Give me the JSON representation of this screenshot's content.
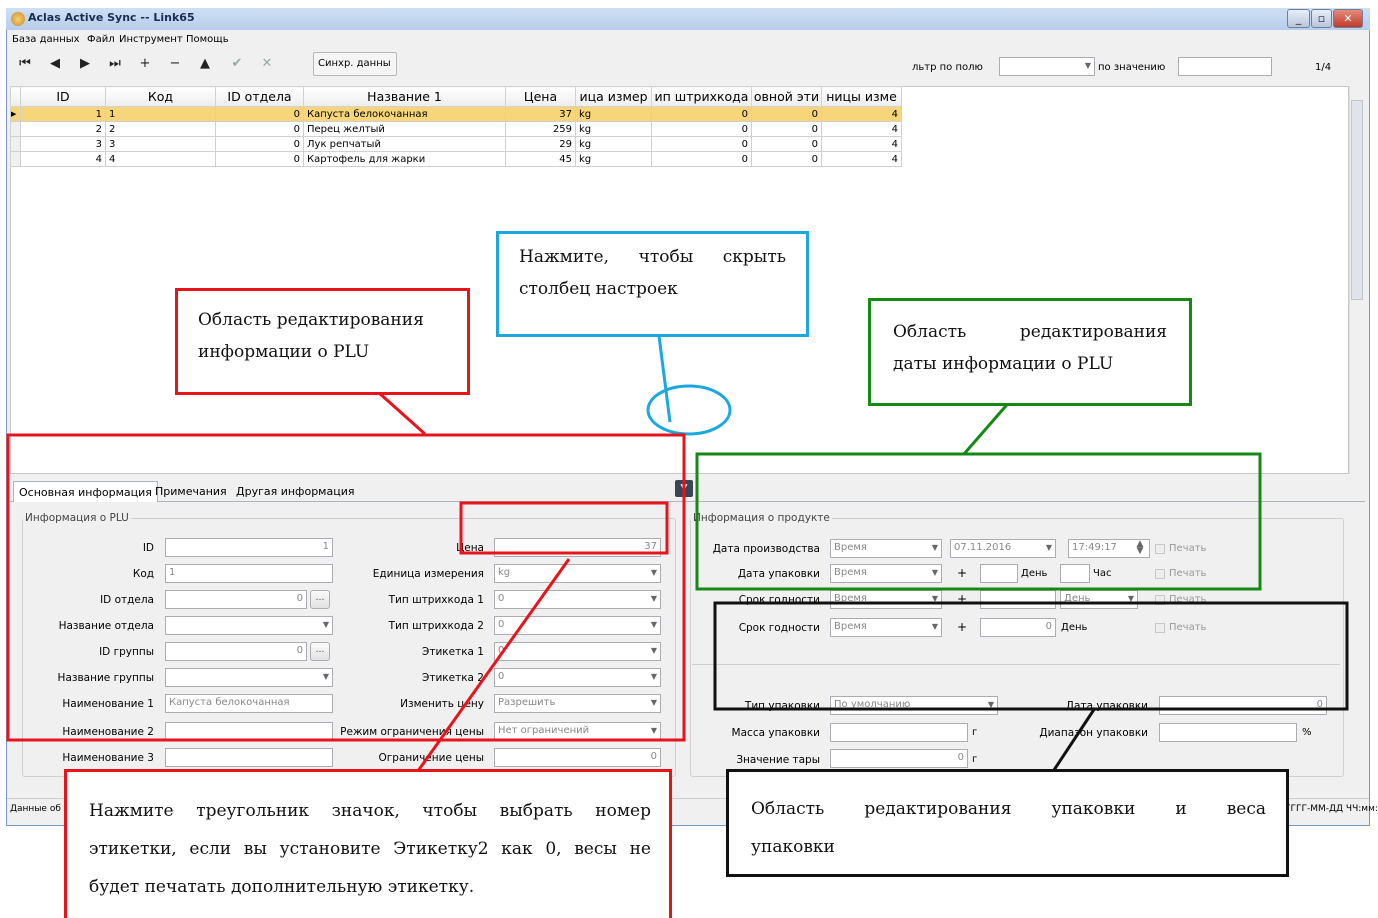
{
  "window": {
    "title": "Aclas Active Sync -- Link65",
    "buttons": [
      "_",
      "▫",
      "✕"
    ]
  },
  "menu": [
    "База данных",
    "Файл",
    "Инструмент",
    "Помощь"
  ],
  "toolbar": {
    "nav": [
      "⏮",
      "◀",
      "▶",
      "⏭",
      "+",
      "−",
      "▲",
      "✔",
      "✕"
    ],
    "sync_label": "Синхр. данны",
    "filter_field_label": "льтр по полю",
    "filter_value_label": "по значению",
    "filter_field_value": "",
    "filter_value": "",
    "page": "1/4"
  },
  "grid": {
    "columns": [
      "ID",
      "Код",
      "ID отдела",
      "Название 1",
      "Цена",
      "ица измер",
      "ип штрихкода",
      "овной эти",
      "ницы изме"
    ],
    "rows": [
      [
        "1",
        "1",
        "0",
        "Капуста белокочанная",
        "37",
        "kg",
        "0",
        "0",
        "4"
      ],
      [
        "2",
        "2",
        "0",
        "Перец желтый",
        "259",
        "kg",
        "0",
        "0",
        "4"
      ],
      [
        "3",
        "3",
        "0",
        "Лук репчатый",
        "29",
        "kg",
        "0",
        "0",
        "4"
      ],
      [
        "4",
        "4",
        "0",
        "Картофель для жарки",
        "45",
        "kg",
        "0",
        "0",
        "4"
      ]
    ]
  },
  "tabs": [
    "Основная информация",
    "Примечания",
    "Другая информация"
  ],
  "collapse_glyph": "▼",
  "plu": {
    "group": "Информация о PLU",
    "labels": {
      "id": "ID",
      "code": "Код",
      "dept_id": "ID отдела",
      "dept_name": "Название отдела",
      "group_id": "ID группы",
      "group_name": "Название группы",
      "name1": "Наименование 1",
      "name2": "Наименование 2",
      "name3": "Наименование 3"
    },
    "values": {
      "id": "1",
      "code": "1",
      "dept_id": "0",
      "dept_name": "",
      "group_id": "0",
      "group_name": "",
      "name1": "Капуста белокочанная",
      "name2": "",
      "name3": ""
    },
    "right_labels": {
      "price": "Цена",
      "unit": "Единица измерения",
      "bc1": "Тип штрихкода 1",
      "bc2": "Тип штрихкода 2",
      "label1": "Этикетка 1",
      "label2": "Этикетка 2",
      "change_price": "Изменить цену",
      "price_limit_mode": "Режим ограничения цены",
      "price_limit": "Ограничение цены"
    },
    "right_values": {
      "price": "37",
      "unit": "kg",
      "bc1": "0",
      "bc2": "0",
      "label1": "0",
      "label2": "0",
      "change_price": "Разрешить",
      "price_limit_mode": "Нет ограничений",
      "price_limit": "0"
    }
  },
  "product": {
    "group": "Информация о продукте",
    "labels": {
      "prod_date": "Дата производства",
      "pack_date": "Дата упаковки",
      "shelf1": "Срок годности",
      "shelf2": "Срок годности"
    },
    "mode": "Время",
    "date": "07.11.2016",
    "time": "17:49:17",
    "plus": "+",
    "day": "День",
    "hour": "Час",
    "print": "Печать",
    "shelf_value": "0"
  },
  "pack": {
    "type_label": "Тип упаковки",
    "type_value": "По умолчанию",
    "date_label": "Дата упаковки",
    "date_value": "0",
    "mass_label": "Масса упаковки",
    "mass_unit": "г",
    "range_label": "Диапазон упаковки",
    "range_unit": "%",
    "tare_label": "Значение тары",
    "tare_value": "0",
    "tare_unit": "г"
  },
  "status": {
    "left": "Данные об",
    "right": "ГГГГ-ММ-ДД ЧЧ:мм:сс"
  },
  "annotations": {
    "hide": [
      "Нажмите, чтобы скрыть",
      "столбец настроек"
    ],
    "plu": [
      "Область редактирования",
      "информации о PLU"
    ],
    "date": [
      "Область редактирования",
      "даты информации о PLU"
    ],
    "triangle": [
      "Нажмите треугольник значок, чтобы выбрать номер",
      "этикетки, если вы установите Этикетку2 как 0, весы не",
      "будет печатать дополнительную этикетку."
    ],
    "pack": [
      "Область редактирования упаковки и веса",
      "упаковки"
    ]
  },
  "colors": {
    "red": "#e8141b",
    "cyan": "#1aa8de",
    "green": "#148a14",
    "black": "#111111",
    "selected_row": "#f7d67a"
  }
}
